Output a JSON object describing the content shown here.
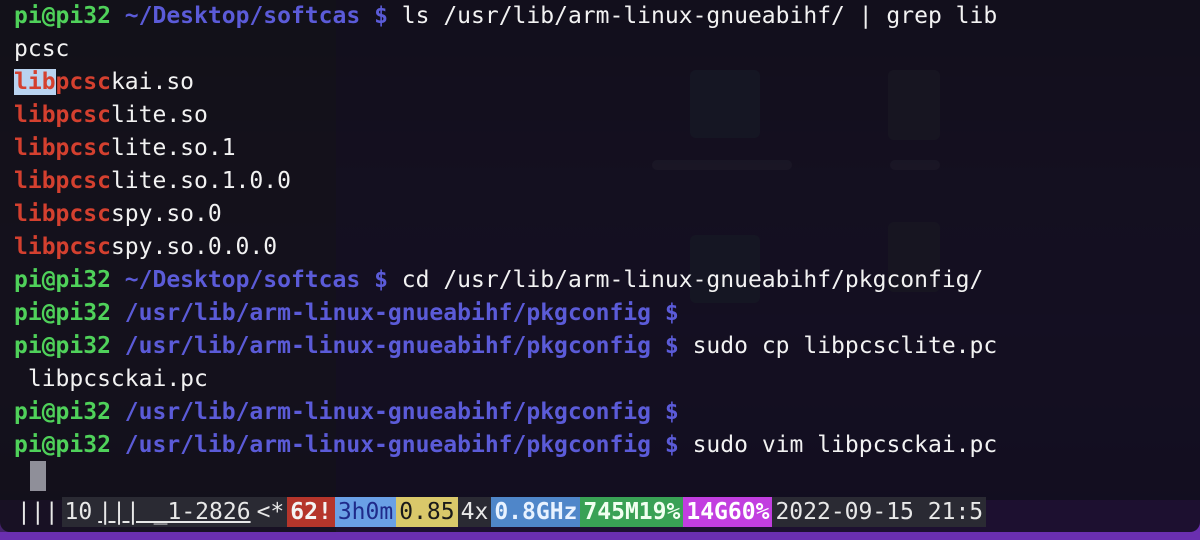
{
  "terminal": {
    "lines": [
      {
        "type": "prompt",
        "user": "pi@pi32",
        "path": "~/Desktop/softcas",
        "dollar": "$",
        "command": "ls /usr/lib/arm-linux-gnueabihf/ | grep lib"
      },
      {
        "type": "output",
        "text": "pcsc"
      },
      {
        "type": "match",
        "match": "libpcsc",
        "rest": "kai.so"
      },
      {
        "type": "match",
        "match": "libpcsc",
        "rest": "lite.so"
      },
      {
        "type": "match",
        "match": "libpcsc",
        "rest": "lite.so.1"
      },
      {
        "type": "match",
        "match": "libpcsc",
        "rest": "lite.so.1.0.0"
      },
      {
        "type": "match",
        "match": "libpcsc",
        "rest": "spy.so.0"
      },
      {
        "type": "match",
        "match": "libpcsc",
        "rest": "spy.so.0.0.0"
      },
      {
        "type": "prompt",
        "user": "pi@pi32",
        "path": "~/Desktop/softcas",
        "dollar": "$",
        "command": "cd /usr/lib/arm-linux-gnueabihf/pkgconfig/"
      },
      {
        "type": "prompt",
        "user": "pi@pi32",
        "path": "/usr/lib/arm-linux-gnueabihf/pkgconfig",
        "dollar": "$",
        "command": ""
      },
      {
        "type": "prompt",
        "user": "pi@pi32",
        "path": "/usr/lib/arm-linux-gnueabihf/pkgconfig",
        "dollar": "$",
        "command": "sudo cp libpcsclite.pc"
      },
      {
        "type": "output",
        "text": " libpcsckai.pc"
      },
      {
        "type": "prompt",
        "user": "pi@pi32",
        "path": "/usr/lib/arm-linux-gnueabihf/pkgconfig",
        "dollar": "$",
        "command": ""
      },
      {
        "type": "prompt",
        "user": "pi@pi32",
        "path": "/usr/lib/arm-linux-gnueabihf/pkgconfig",
        "dollar": "$",
        "command": "sudo vim libpcsckai.pc"
      }
    ]
  },
  "statusbar": {
    "menu": "|||",
    "window_num": "10",
    "window_name": "||| _1-2826",
    "marker": "<*",
    "alert": "62!",
    "uptime": "3h0m",
    "load": "0.85",
    "cpu_count": "4x",
    "cpu_freq": "0.8GHz",
    "mem": "745M19%",
    "disk": "14G60%",
    "datetime": "2022-09-15 21:5"
  },
  "colors": {
    "user": "#4fd15a",
    "path": "#5b5bd8",
    "match": "#d4402f"
  }
}
